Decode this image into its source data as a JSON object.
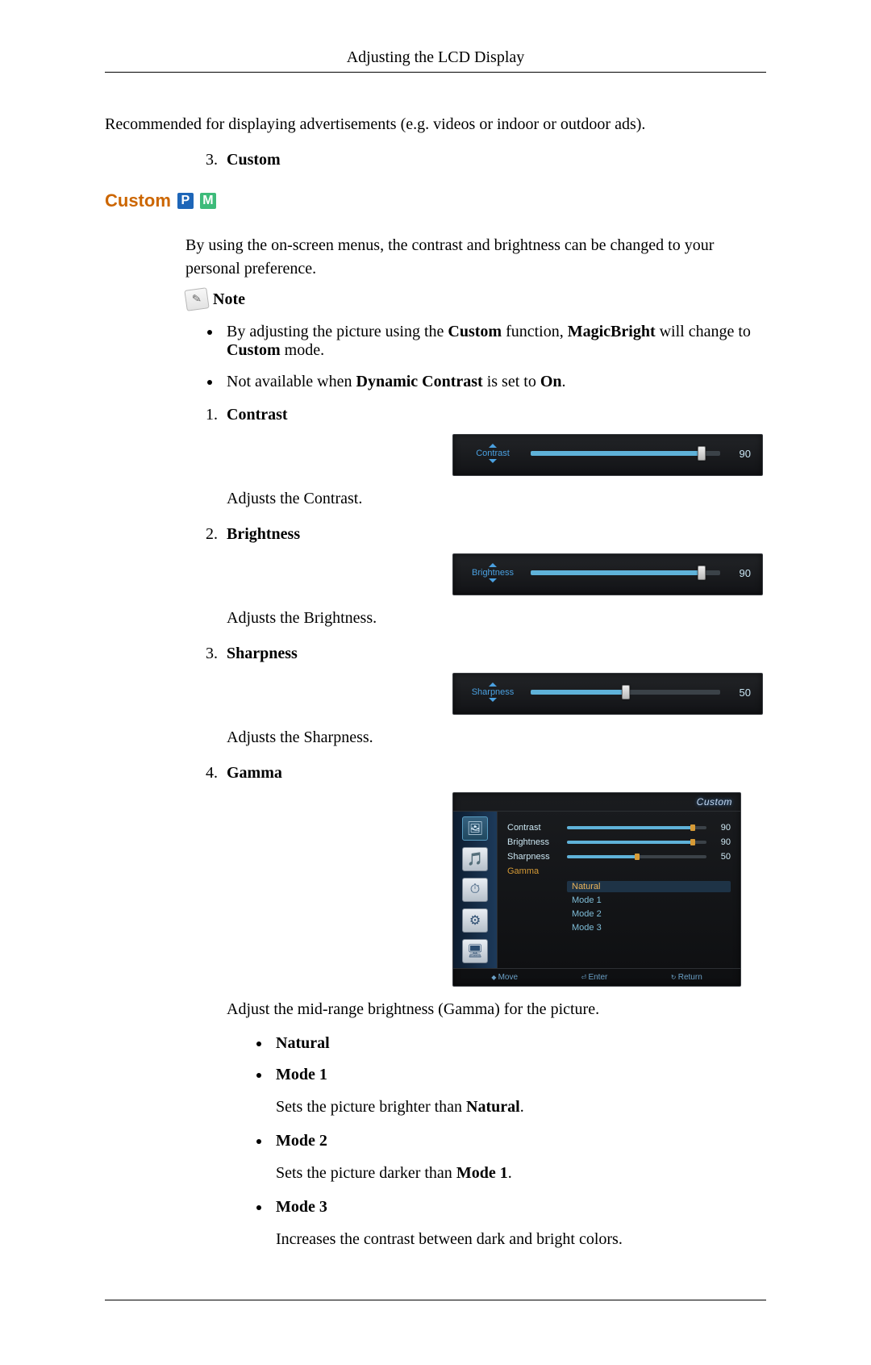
{
  "header": {
    "title": "Adjusting the LCD Display"
  },
  "intro_para": "Recommended for displaying advertisements (e.g. videos or indoor or outdoor ads).",
  "pre_list": {
    "num": "3.",
    "label": "Custom"
  },
  "section": {
    "title": "Custom",
    "badge_p": "P",
    "badge_m": "M",
    "intro": "By using the on-screen menus, the contrast and brightness can be changed to your personal preference.",
    "note_label": "Note",
    "bullets": [
      {
        "pre": "By adjusting the picture using the ",
        "b1": "Custom",
        "mid": " function, ",
        "b2": "MagicBright",
        "mid2": " will change to ",
        "b3": "Custom",
        "post": " mode."
      },
      {
        "pre": "Not available when ",
        "b1": "Dynamic Contrast",
        "mid": " is set to ",
        "b2": "On",
        "post": "."
      }
    ],
    "items": [
      {
        "num": "1.",
        "title": "Contrast",
        "desc": "Adjusts the Contrast.",
        "osd": {
          "label": "Contrast",
          "value": 90
        }
      },
      {
        "num": "2.",
        "title": "Brightness",
        "desc": "Adjusts the Brightness.",
        "osd": {
          "label": "Brightness",
          "value": 90
        }
      },
      {
        "num": "3.",
        "title": "Sharpness",
        "desc": "Adjusts the Sharpness.",
        "osd": {
          "label": "Sharpness",
          "value": 50
        }
      },
      {
        "num": "4.",
        "title": "Gamma",
        "menu": {
          "header": "Custom",
          "rows": [
            {
              "label": "Contrast",
              "value": 90
            },
            {
              "label": "Brightness",
              "value": 90
            },
            {
              "label": "Sharpness",
              "value": 50
            }
          ],
          "gamma_label": "Gamma",
          "gamma_options": [
            "Natural",
            "Mode 1",
            "Mode 2",
            "Mode 3"
          ],
          "gamma_selected": "Natural",
          "footer": {
            "move": "Move",
            "enter": "Enter",
            "return": "Return"
          }
        },
        "desc": "Adjust the mid-range brightness (Gamma) for the picture.",
        "sub": [
          {
            "label": "Natural",
            "text": ""
          },
          {
            "label": "Mode 1",
            "pre": "Sets the picture brighter than ",
            "b": "Natural",
            "post": "."
          },
          {
            "label": "Mode 2",
            "pre": "Sets the picture darker than ",
            "b": "Mode 1",
            "post": "."
          },
          {
            "label": "Mode 3",
            "text": "Increases the contrast between dark and bright colors."
          }
        ]
      }
    ]
  }
}
